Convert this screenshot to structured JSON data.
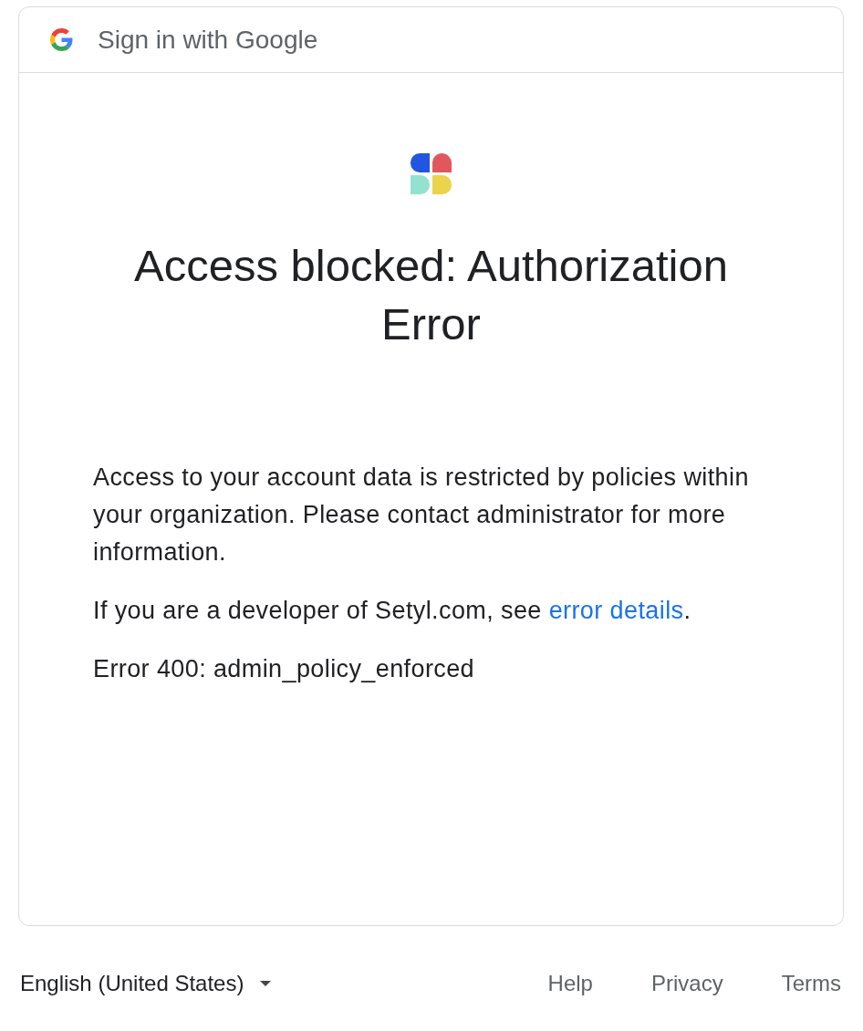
{
  "header": {
    "title": "Sign in with Google"
  },
  "content": {
    "heading": "Access blocked: Authorization Error",
    "paragraphs": [
      {
        "kind": "text",
        "text": "Access to your account data is restricted by policies within your organization. Please contact administrator for more information."
      },
      {
        "kind": "link",
        "text": "If you are a developer of Setyl.com, see ",
        "link": "error details",
        "after": "."
      },
      {
        "kind": "text",
        "text": "Error 400: admin_policy_enforced"
      }
    ]
  },
  "footer": {
    "language": "English (United States)",
    "links": [
      "Help",
      "Privacy",
      "Terms"
    ]
  }
}
